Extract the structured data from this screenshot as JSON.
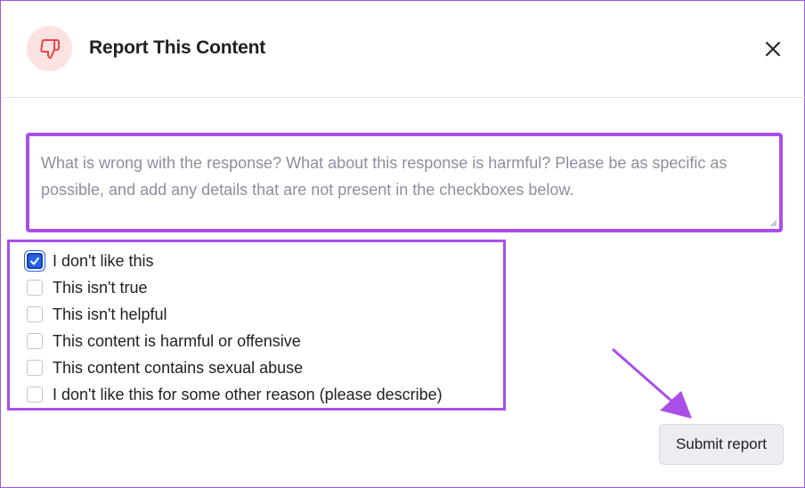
{
  "dialog": {
    "title": "Report This Content",
    "header_icon": "thumbs-down-icon",
    "close_icon": "close-icon"
  },
  "feedback": {
    "value": "",
    "placeholder": "What is wrong with the response? What about this response is harmful? Please be as specific as possible, and add any details that are not present in the checkboxes below."
  },
  "options": [
    {
      "label": "I don't like this",
      "checked": true
    },
    {
      "label": "This isn't true",
      "checked": false
    },
    {
      "label": "This isn't helpful",
      "checked": false
    },
    {
      "label": "This content is harmful or offensive",
      "checked": false
    },
    {
      "label": "This content contains sexual abuse",
      "checked": false
    },
    {
      "label": "I don't like this for some other reason (please describe)",
      "checked": false
    }
  ],
  "actions": {
    "submit_label": "Submit report"
  },
  "colors": {
    "highlight": "#a94fe8",
    "checkbox_checked": "#2563eb",
    "icon_bg": "#fde2e2",
    "icon_stroke": "#ef4444"
  }
}
